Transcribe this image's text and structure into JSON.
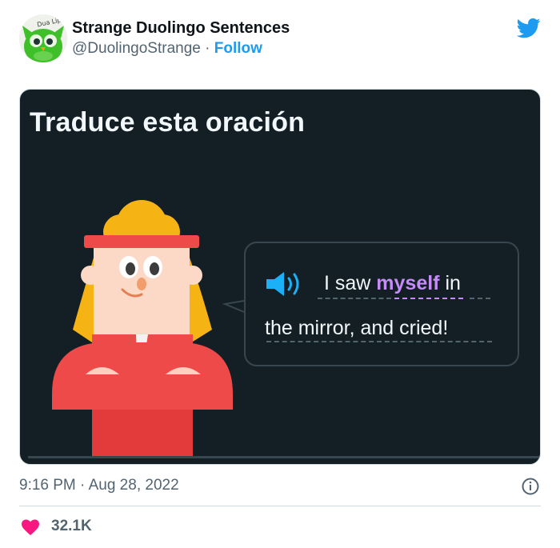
{
  "tweet": {
    "display_name": "Strange Duolingo Sentences",
    "handle": "@DuolingoStrange",
    "separator": " · ",
    "follow_label": "Follow",
    "avatar_text": "Dua Lipa",
    "timestamp": "9:16 PM · Aug 28, 2022",
    "likes_count": "32.1K"
  },
  "media": {
    "title": "Traduce esta oración",
    "sentence": {
      "line1_before": "I saw ",
      "line1_highlight": "myself",
      "line1_after": " in",
      "line2": "the mirror, and cried!"
    }
  },
  "colors": {
    "brand_blue": "#1d9bf0",
    "like_pink": "#f91880",
    "card_bg": "#131f24",
    "highlight_purple": "#c58cf5",
    "speaker_blue": "#1cb0f6"
  },
  "icons": [
    "twitter-bird-icon",
    "speaker-icon",
    "info-icon",
    "heart-icon"
  ]
}
